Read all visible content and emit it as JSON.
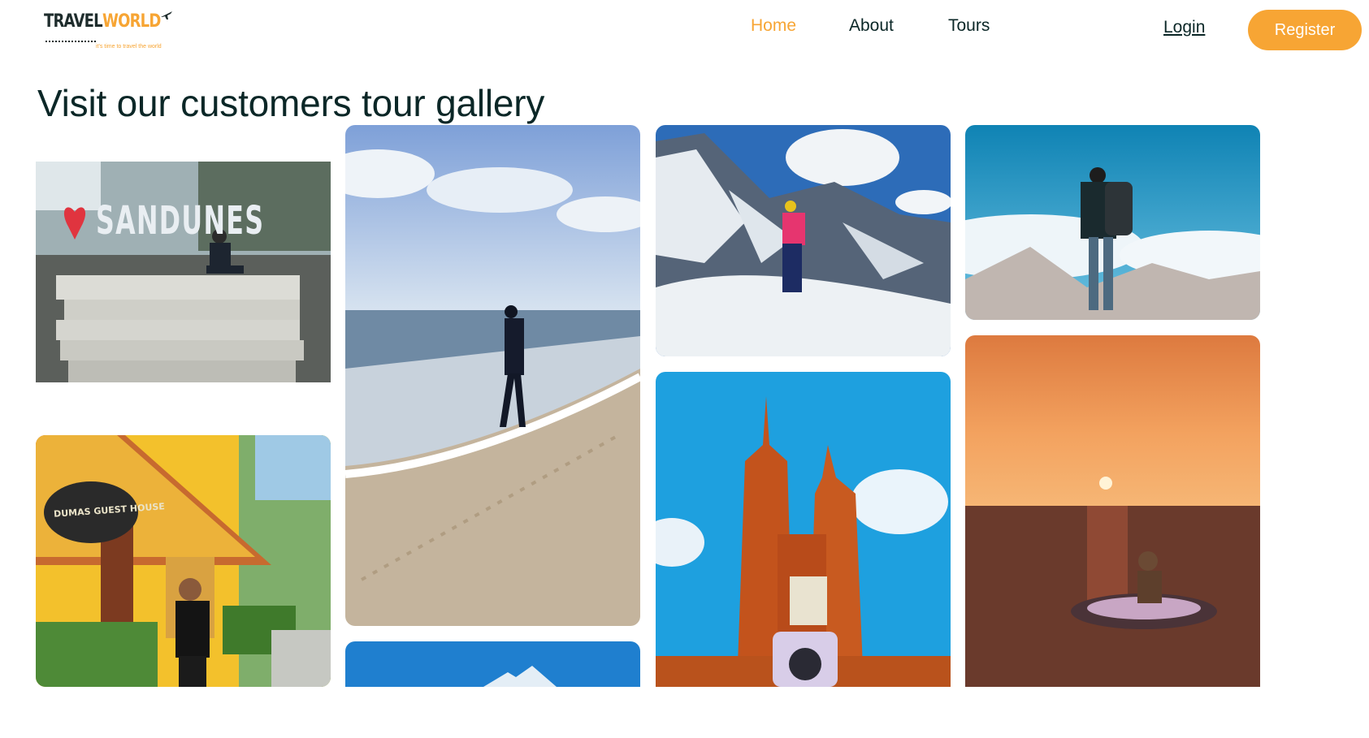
{
  "brand": {
    "name_part1": "TRAVEL",
    "name_part2": "WORLD",
    "tagline": "it's time to travel the world"
  },
  "nav": {
    "items": [
      {
        "label": "Home",
        "active": true
      },
      {
        "label": "About",
        "active": false
      },
      {
        "label": "Tours",
        "active": false
      }
    ],
    "login_label": "Login",
    "register_label": "Register"
  },
  "gallery": {
    "title": "Visit our customers tour gallery",
    "sign_text": "SANDUNES",
    "guest_house_sign": "DUMAS GUEST HOUSE"
  },
  "colors": {
    "accent": "#f7a534",
    "heading": "#0b2727",
    "background": "#ffffff"
  }
}
